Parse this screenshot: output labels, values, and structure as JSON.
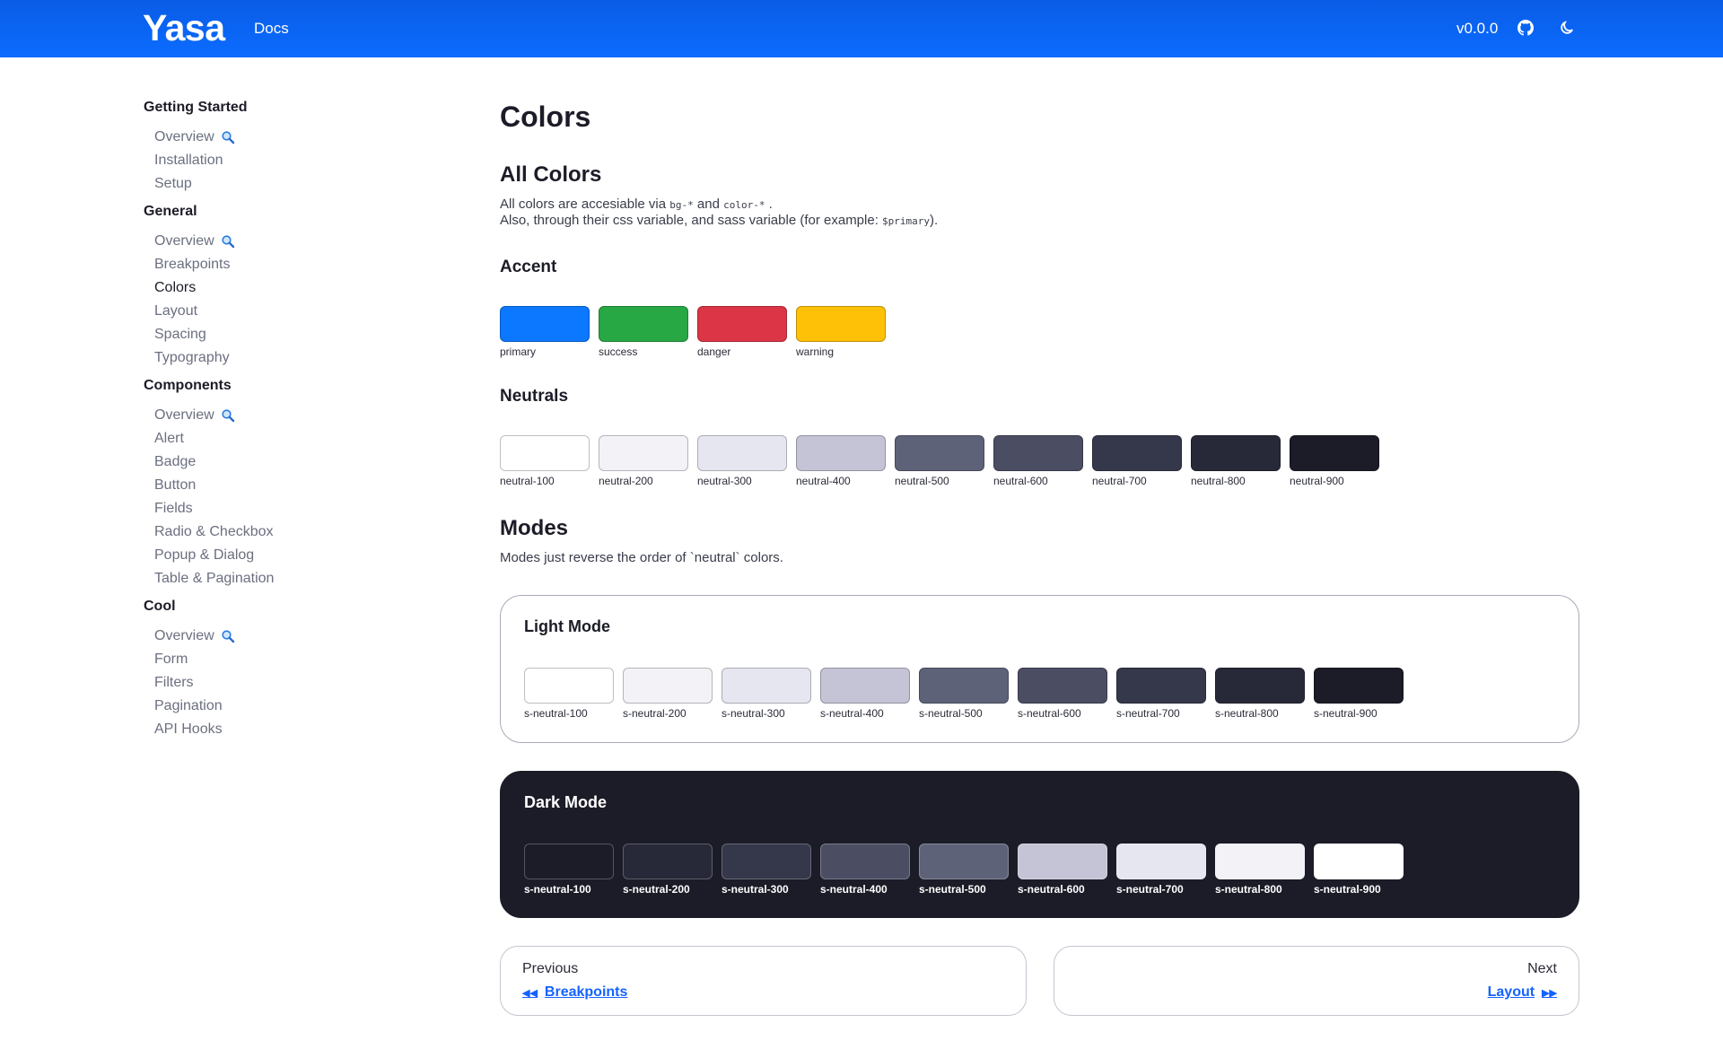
{
  "header": {
    "logo": "Yasa",
    "docs_label": "Docs",
    "version": "v0.0.0",
    "github_icon": "github-icon",
    "theme_icon": "moon-icon"
  },
  "sidebar": {
    "groups": [
      {
        "title": "Getting Started",
        "items": [
          {
            "label": "Overview",
            "icon": "magnifier-icon"
          },
          {
            "label": "Installation"
          },
          {
            "label": "Setup"
          }
        ]
      },
      {
        "title": "General",
        "items": [
          {
            "label": "Overview",
            "icon": "magnifier-icon"
          },
          {
            "label": "Breakpoints"
          },
          {
            "label": "Colors",
            "active": true
          },
          {
            "label": "Layout"
          },
          {
            "label": "Spacing"
          },
          {
            "label": "Typography"
          }
        ]
      },
      {
        "title": "Components",
        "items": [
          {
            "label": "Overview",
            "icon": "magnifier-icon"
          },
          {
            "label": "Alert"
          },
          {
            "label": "Badge"
          },
          {
            "label": "Button"
          },
          {
            "label": "Fields"
          },
          {
            "label": "Radio & Checkbox"
          },
          {
            "label": "Popup & Dialog"
          },
          {
            "label": "Table & Pagination"
          }
        ]
      },
      {
        "title": "Cool",
        "items": [
          {
            "label": "Overview",
            "icon": "magnifier-icon"
          },
          {
            "label": "Form"
          },
          {
            "label": "Filters"
          },
          {
            "label": "Pagination"
          },
          {
            "label": "API Hooks"
          }
        ]
      }
    ]
  },
  "main": {
    "title": "Colors",
    "all_colors": {
      "heading": "All Colors",
      "line1_prefix": "All colors are accesiable via ",
      "code_bg": "bg-*",
      "line1_and": " and ",
      "code_color": "color-*",
      "line1_suffix": " .",
      "line2_prefix": "Also, through their css variable, and sass variable (for example: ",
      "code_primary": "$primary",
      "line2_suffix": ")."
    },
    "accent": {
      "heading": "Accent",
      "swatches": [
        {
          "name": "primary",
          "color": "#0b78ff"
        },
        {
          "name": "success",
          "color": "#28a745"
        },
        {
          "name": "danger",
          "color": "#dc3545"
        },
        {
          "name": "warning",
          "color": "#ffc107"
        }
      ]
    },
    "neutrals": {
      "heading": "Neutrals",
      "swatches": [
        {
          "name": "neutral-100",
          "color": "#ffffff"
        },
        {
          "name": "neutral-200",
          "color": "#f2f2f7"
        },
        {
          "name": "neutral-300",
          "color": "#e6e6f0"
        },
        {
          "name": "neutral-400",
          "color": "#c4c4d6"
        },
        {
          "name": "neutral-500",
          "color": "#5e6278"
        },
        {
          "name": "neutral-600",
          "color": "#4b4e63"
        },
        {
          "name": "neutral-700",
          "color": "#35374a"
        },
        {
          "name": "neutral-800",
          "color": "#282938"
        },
        {
          "name": "neutral-900",
          "color": "#1c1c28"
        }
      ]
    },
    "modes": {
      "heading": "Modes",
      "description": "Modes just reverse the order of `neutral` colors.",
      "light": {
        "title": "Light Mode",
        "swatches": [
          {
            "name": "s-neutral-100",
            "color": "#ffffff"
          },
          {
            "name": "s-neutral-200",
            "color": "#f2f2f7"
          },
          {
            "name": "s-neutral-300",
            "color": "#e6e6f0"
          },
          {
            "name": "s-neutral-400",
            "color": "#c4c4d6"
          },
          {
            "name": "s-neutral-500",
            "color": "#5e6278"
          },
          {
            "name": "s-neutral-600",
            "color": "#4b4e63"
          },
          {
            "name": "s-neutral-700",
            "color": "#35374a"
          },
          {
            "name": "s-neutral-800",
            "color": "#282938"
          },
          {
            "name": "s-neutral-900",
            "color": "#1c1c28"
          }
        ]
      },
      "dark": {
        "title": "Dark Mode",
        "swatches": [
          {
            "name": "s-neutral-100",
            "color": "#1c1c28"
          },
          {
            "name": "s-neutral-200",
            "color": "#282938"
          },
          {
            "name": "s-neutral-300",
            "color": "#35374a"
          },
          {
            "name": "s-neutral-400",
            "color": "#4b4e63"
          },
          {
            "name": "s-neutral-500",
            "color": "#5e6278"
          },
          {
            "name": "s-neutral-600",
            "color": "#c4c4d6"
          },
          {
            "name": "s-neutral-700",
            "color": "#e6e6f0"
          },
          {
            "name": "s-neutral-800",
            "color": "#f2f2f7"
          },
          {
            "name": "s-neutral-900",
            "color": "#ffffff"
          }
        ]
      }
    },
    "pager": {
      "prev_label": "Previous",
      "prev_link": "Breakpoints",
      "next_label": "Next",
      "next_link": "Layout",
      "prev_icon": "double-chevron-left-icon",
      "next_icon": "double-chevron-right-icon"
    }
  }
}
